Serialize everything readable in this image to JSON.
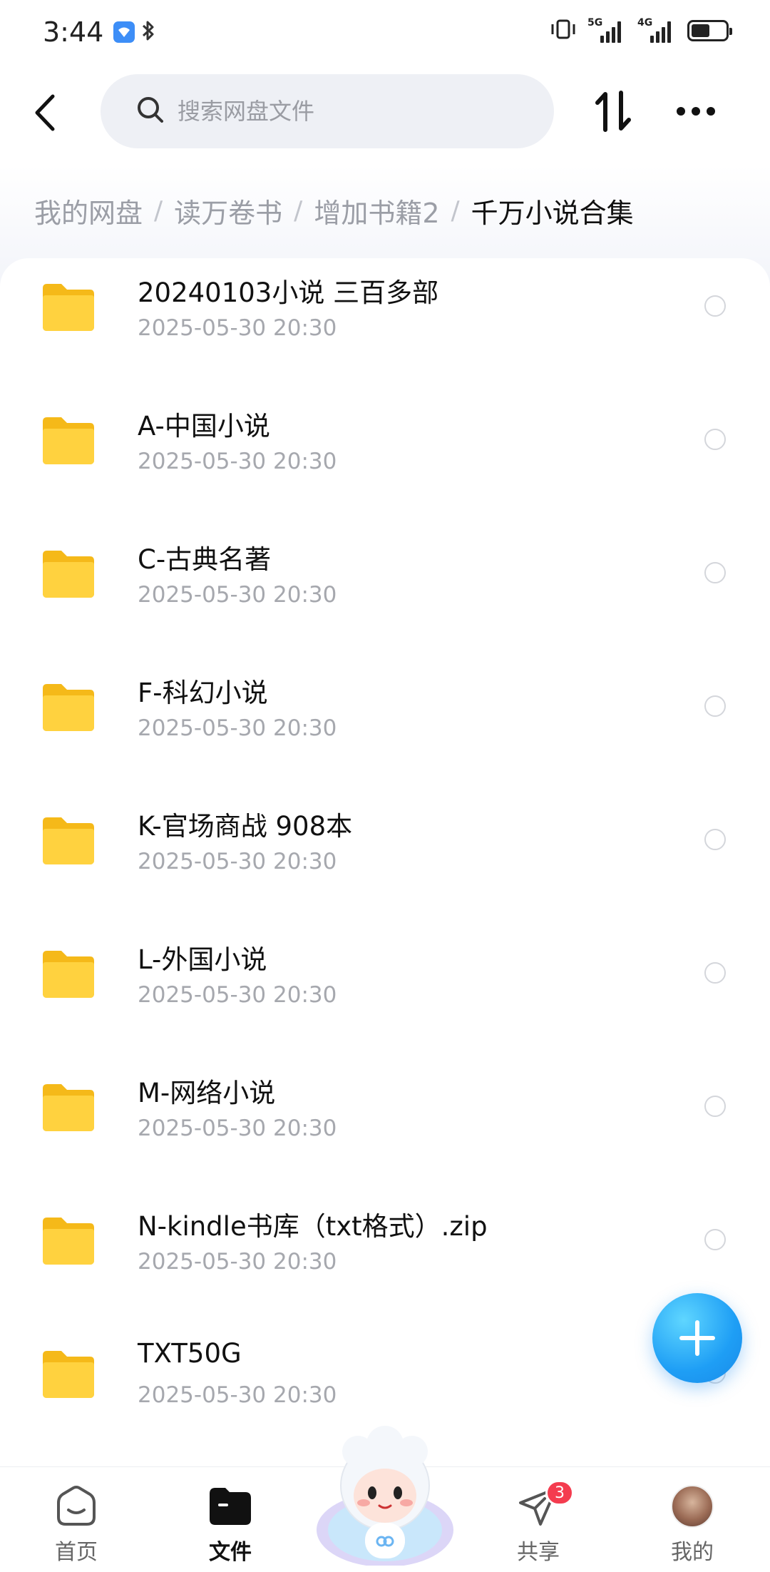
{
  "status_bar": {
    "time": "3:44",
    "net1_label": "5G",
    "net2_label": "4G",
    "battery_level": 0.55
  },
  "header": {
    "search_placeholder": "搜索网盘文件"
  },
  "breadcrumb": {
    "items": [
      "我的网盘",
      "读万卷书",
      "增加书籍2"
    ],
    "current": "千万小说合集"
  },
  "files": [
    {
      "name": "20240103小说 三百多部",
      "date": "2025-05-30  20:30"
    },
    {
      "name": "A-中国小说",
      "date": "2025-05-30  20:30"
    },
    {
      "name": "C-古典名著",
      "date": "2025-05-30  20:30"
    },
    {
      "name": "F-科幻小说",
      "date": "2025-05-30  20:30"
    },
    {
      "name": "K-官场商战 908本",
      "date": "2025-05-30  20:30"
    },
    {
      "name": "L-外国小说",
      "date": "2025-05-30  20:30"
    },
    {
      "name": "M-网络小说",
      "date": "2025-05-30  20:30"
    },
    {
      "name": "N-kindle书库（txt格式）.zip",
      "date": "2025-05-30  20:30"
    },
    {
      "name": "TXT50G",
      "date": "2025-05-30  20:30"
    }
  ],
  "bottom_nav": {
    "home": "首页",
    "files": "文件",
    "share": "共享",
    "share_badge": "3",
    "mine": "我的"
  },
  "colors": {
    "accent": "#1e9ef5",
    "folder": "#ffd23f",
    "badge": "#f43c4f"
  }
}
